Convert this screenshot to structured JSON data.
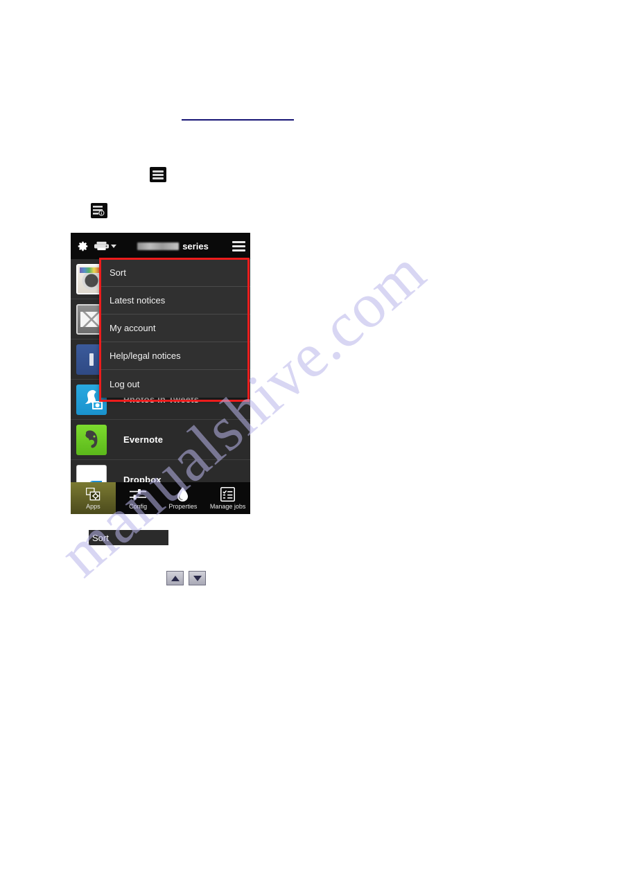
{
  "document": {
    "link_rule": "",
    "inline_icons": [
      {
        "name": "hamburger-menu-icon",
        "label": "menu"
      },
      {
        "name": "menu-with-info-icon",
        "label": "menu info"
      }
    ],
    "sort_chip_label": "Sort",
    "arrow_up_label": "▲",
    "arrow_down_label": "▼"
  },
  "watermark": {
    "text": "manualshive.com",
    "color": "#b9b6ea"
  },
  "device": {
    "topbar": {
      "gear_icon": "gear-icon",
      "printer_icon": "printer-icon",
      "caret_icon": "chevron-down-icon",
      "model_name_redacted": "",
      "series_label": "series",
      "hamburger_icon": "hamburger-menu-icon"
    },
    "menu": {
      "border_color": "#ec1c1c",
      "items": [
        {
          "label": "Sort"
        },
        {
          "label": "Latest notices"
        },
        {
          "label": "My account"
        },
        {
          "label": "Help/legal notices"
        },
        {
          "label": "Log out"
        }
      ]
    },
    "apps": [
      {
        "label": "",
        "icon": "instagram-icon"
      },
      {
        "label": "",
        "icon": "mail-icon"
      },
      {
        "label": "",
        "icon": "facebook-icon"
      },
      {
        "label": "Photos in Tweets",
        "icon": "twitter-bird-icon"
      },
      {
        "label": "Evernote",
        "icon": "evernote-elephant-icon"
      },
      {
        "label": "Dropbox",
        "icon": "dropbox-icon"
      }
    ],
    "tabs": [
      {
        "label": "Apps",
        "icon": "apps-icon",
        "active": true
      },
      {
        "label": "Config",
        "icon": "sliders-icon",
        "active": false
      },
      {
        "label": "Properties",
        "icon": "ink-drop-icon",
        "active": false
      },
      {
        "label": "Manage jobs",
        "icon": "checklist-icon",
        "active": false
      }
    ]
  }
}
